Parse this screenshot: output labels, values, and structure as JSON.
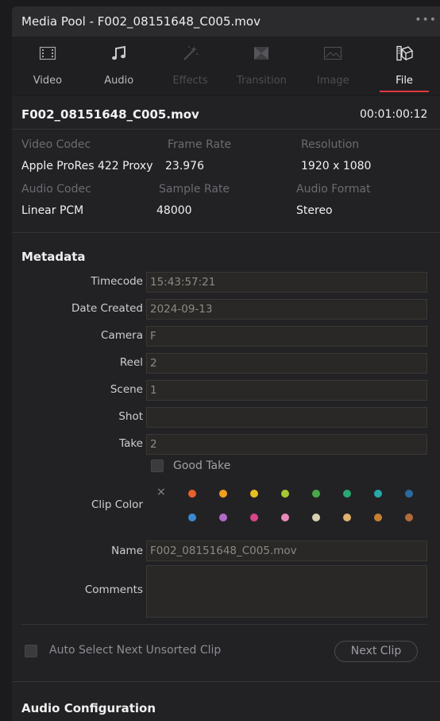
{
  "window": {
    "title": "Media Pool - F002_08151648_C005.mov",
    "more_icon": "•••"
  },
  "tabs": [
    {
      "label": "Video",
      "icon": "video-icon",
      "state": "enabled"
    },
    {
      "label": "Audio",
      "icon": "audio-icon",
      "state": "enabled"
    },
    {
      "label": "Effects",
      "icon": "effects-icon",
      "state": "disabled"
    },
    {
      "label": "Transition",
      "icon": "transition-icon",
      "state": "disabled"
    },
    {
      "label": "Image",
      "icon": "image-icon",
      "state": "disabled"
    },
    {
      "label": "File",
      "icon": "file-icon",
      "state": "active"
    }
  ],
  "file": {
    "name": "F002_08151648_C005.mov",
    "duration": "00:01:00:12",
    "video_codec_label": "Video Codec",
    "video_codec": "Apple ProRes 422 Proxy",
    "frame_rate_label": "Frame Rate",
    "frame_rate": "23.976",
    "resolution_label": "Resolution",
    "resolution": "1920 x 1080",
    "audio_codec_label": "Audio Codec",
    "audio_codec": "Linear PCM",
    "sample_rate_label": "Sample Rate",
    "sample_rate": "48000",
    "audio_format_label": "Audio Format",
    "audio_format": "Stereo"
  },
  "metadata": {
    "heading": "Metadata",
    "timecode_label": "Timecode",
    "timecode": "15:43:57:21",
    "date_label": "Date Created",
    "date": "2024-09-13",
    "camera_label": "Camera",
    "camera": "F",
    "reel_label": "Reel",
    "reel": "2",
    "scene_label": "Scene",
    "scene": "1",
    "shot_label": "Shot",
    "shot": "",
    "take_label": "Take",
    "take": "2",
    "good_take_label": "Good Take",
    "clip_color_label": "Clip Color",
    "clear_color_icon": "×",
    "clip_colors_row1": [
      "#e8612c",
      "#f0a020",
      "#e8c020",
      "#a6c832",
      "#4aa84a",
      "#2aa872",
      "#27a8a8",
      "#2a6aa0"
    ],
    "clip_colors_row2": [
      "#3a8ad0",
      "#b06ac8",
      "#d8458a",
      "#e88ab8",
      "#d8d0b0",
      "#e0b070",
      "#c88030",
      "#b06a3a"
    ],
    "name_label": "Name",
    "name": "F002_08151648_C005.mov",
    "comments_label": "Comments",
    "comments": ""
  },
  "footer": {
    "auto_select_label": "Auto Select Next Unsorted Clip",
    "next_clip_label": "Next Clip",
    "audio_config_heading": "Audio Configuration"
  },
  "colors": {
    "accent": "#e0383c"
  }
}
